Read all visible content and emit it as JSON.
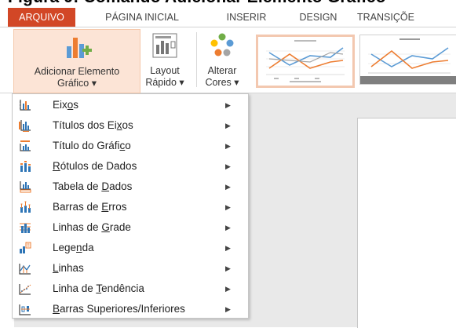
{
  "heading_fragment": "Figura 9: Comando Adicionar Elemento Gráfico",
  "tabs": [
    {
      "label": "ARQUIVO",
      "active": true
    },
    {
      "label": "PÁGINA INICIAL"
    },
    {
      "label": "INSERIR"
    },
    {
      "label": "DESIGN"
    },
    {
      "label": "TRANSIÇÕE"
    }
  ],
  "ribbon": {
    "add_element": {
      "line1": "Adicionar Elemento",
      "line2": "Gráfico ▾"
    },
    "quick_layout": {
      "line1": "Layout",
      "line2": "Rápido ▾"
    },
    "change_colors": {
      "line1": "Alterar",
      "line2": "Cores ▾"
    }
  },
  "menu": {
    "items": [
      {
        "label": "Eixos",
        "accel": "o",
        "icon": "axes-icon"
      },
      {
        "label": "Títulos dos Eixos",
        "accel": "x",
        "icon": "axis-titles-icon"
      },
      {
        "label": "Título do Gráfico",
        "accel": "c",
        "icon": "chart-title-icon"
      },
      {
        "label": "Rótulos de Dados",
        "accel": "R",
        "icon": "data-labels-icon"
      },
      {
        "label": "Tabela de Dados",
        "accel": "D",
        "icon": "data-table-icon"
      },
      {
        "label": "Barras de Erros",
        "accel": "E",
        "icon": "error-bars-icon"
      },
      {
        "label": "Linhas de Grade",
        "accel": "G",
        "icon": "gridlines-icon"
      },
      {
        "label": "Legenda",
        "accel": "n",
        "icon": "legend-icon"
      },
      {
        "label": "Linhas",
        "accel": "L",
        "icon": "lines-icon"
      },
      {
        "label": "Linha de Tendência",
        "accel": "T",
        "icon": "trendline-icon"
      },
      {
        "label": "Barras Superiores/Inferiores",
        "accel": "B",
        "icon": "up-down-bars-icon"
      }
    ],
    "submenu_arrow": "▶"
  },
  "colors": {
    "file_tab": "#d24726",
    "active_button_bg": "#fce4d6",
    "accent_orange": "#ed7d31",
    "accent_blue": "#5b9bd5",
    "menu_icon_blue": "#2e75b6"
  }
}
